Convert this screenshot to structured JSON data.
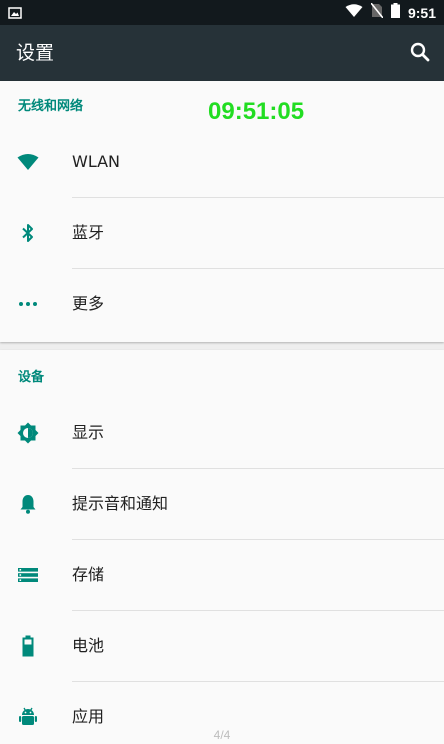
{
  "status_bar": {
    "time": "9:51",
    "icons": [
      "image-notification-icon",
      "wifi-icon",
      "no-sim-icon",
      "battery-icon"
    ]
  },
  "app_bar": {
    "title": "设置",
    "search_icon": "search-icon"
  },
  "overlay": {
    "clock": "09:51:05"
  },
  "sections": {
    "wireless": {
      "header": "无线和网络",
      "items": [
        {
          "label": "WLAN",
          "icon": "wifi-icon"
        },
        {
          "label": "蓝牙",
          "icon": "bluetooth-icon"
        },
        {
          "label": "更多",
          "icon": "more-dots-icon"
        }
      ]
    },
    "device": {
      "header": "设备",
      "items": [
        {
          "label": "显示",
          "icon": "brightness-icon"
        },
        {
          "label": "提示音和通知",
          "icon": "bell-icon"
        },
        {
          "label": "存储",
          "icon": "storage-icon"
        },
        {
          "label": "电池",
          "icon": "battery-icon"
        },
        {
          "label": "应用",
          "icon": "android-icon"
        }
      ]
    }
  },
  "page_indicator": "4/4",
  "colors": {
    "accent": "#00897b",
    "app_bar": "#263238",
    "status_bar": "#12191d",
    "overlay_clock": "#22dd22"
  }
}
